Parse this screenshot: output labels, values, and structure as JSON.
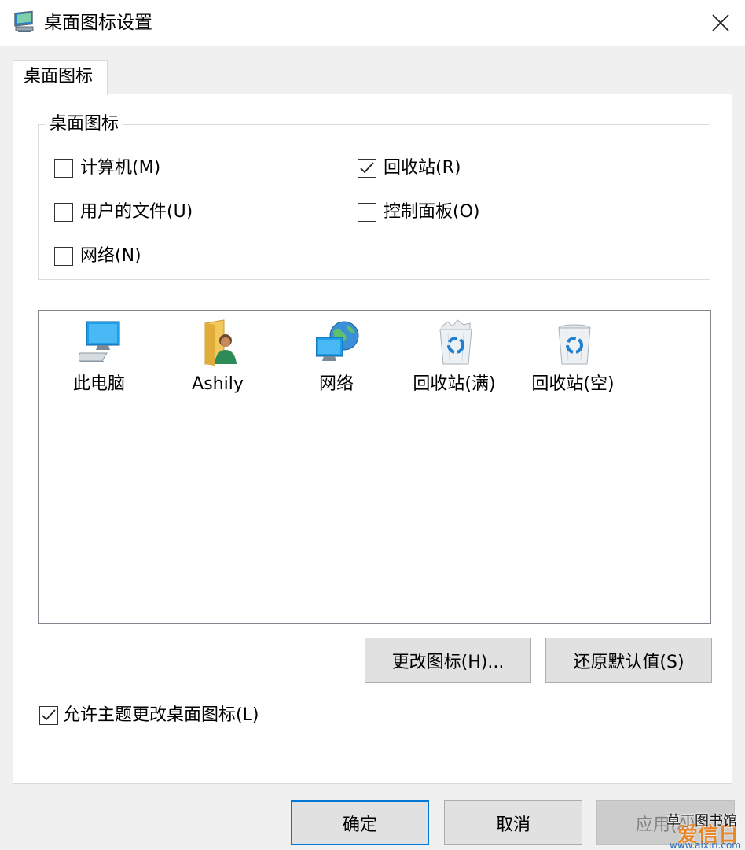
{
  "window": {
    "title": "桌面图标设置"
  },
  "tabs": [
    {
      "label": "桌面图标"
    }
  ],
  "group": {
    "legend": "桌面图标",
    "checkboxes": [
      {
        "label": "计算机(M)",
        "checked": false
      },
      {
        "label": "回收站(R)",
        "checked": true
      },
      {
        "label": "用户的文件(U)",
        "checked": false
      },
      {
        "label": "控制面板(O)",
        "checked": false
      },
      {
        "label": "网络(N)",
        "checked": false
      }
    ]
  },
  "icons": [
    {
      "label": "此电脑",
      "icon": "computer-icon"
    },
    {
      "label": "Ashily",
      "icon": "user-folder-icon"
    },
    {
      "label": "网络",
      "icon": "network-icon"
    },
    {
      "label": "回收站(满)",
      "icon": "recycle-bin-full-icon"
    },
    {
      "label": "回收站(空)",
      "icon": "recycle-bin-empty-icon"
    }
  ],
  "buttons": {
    "change_icon": "更改图标(H)...",
    "restore_default": "还原默认值(S)",
    "ok": "确定",
    "cancel": "取消",
    "apply": "应用(A)"
  },
  "allow_themes": {
    "label": "允许主题更改桌面图标(L)",
    "checked": true
  },
  "watermark": {
    "top": "草丁图书馆",
    "big": "爱信日",
    "url": "www.aixiri.com"
  },
  "colors": {
    "accent": "#0078d7",
    "window_bg": "#f0f0f0",
    "panel_bg": "#ffffff"
  }
}
